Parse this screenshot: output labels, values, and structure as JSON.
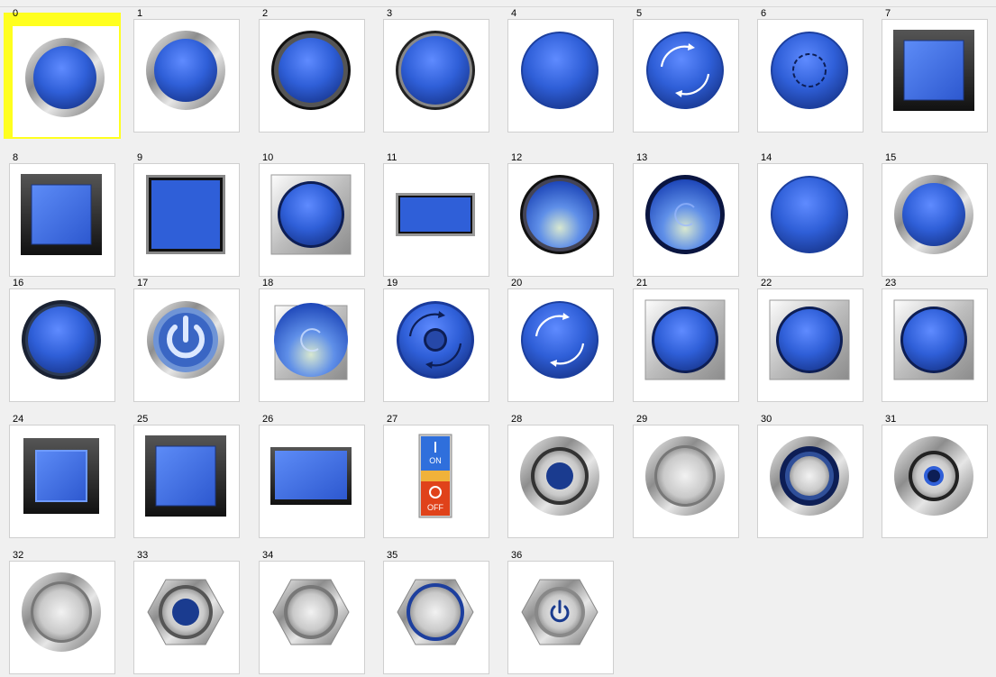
{
  "colors": {
    "accent": "#2f5fd8",
    "selection": "#ffff1f"
  },
  "buttons": [
    {
      "label": "0",
      "style": "round-chrome-bezel"
    },
    {
      "label": "1",
      "style": "round-chrome-bezel"
    },
    {
      "label": "2",
      "style": "round-black-bezel"
    },
    {
      "label": "3",
      "style": "round-thin-black-ring"
    },
    {
      "label": "4",
      "style": "round-flat"
    },
    {
      "label": "5",
      "style": "round-rotate-arrows"
    },
    {
      "label": "6",
      "style": "round-dashed-circle"
    },
    {
      "label": "7",
      "style": "square-black-bezel"
    },
    {
      "label": "8",
      "style": "square-black-bezel"
    },
    {
      "label": "9",
      "style": "square-thin-frame"
    },
    {
      "label": "10",
      "style": "round-on-metal-plate"
    },
    {
      "label": "11",
      "style": "rectangle"
    },
    {
      "label": "12",
      "style": "round-glossy-dark-ring"
    },
    {
      "label": "13",
      "style": "round-glossy-swirl"
    },
    {
      "label": "14",
      "style": "round-flat"
    },
    {
      "label": "15",
      "style": "round-chrome-bezel"
    },
    {
      "label": "16",
      "style": "round-dark-ring"
    },
    {
      "label": "17",
      "style": "power-symbol"
    },
    {
      "label": "18",
      "style": "round-glossy-swirl-plate"
    },
    {
      "label": "19",
      "style": "round-rotate-dark-center"
    },
    {
      "label": "20",
      "style": "round-rotate-arrows"
    },
    {
      "label": "21",
      "style": "round-on-metal-plate"
    },
    {
      "label": "22",
      "style": "round-on-metal-plate"
    },
    {
      "label": "23",
      "style": "round-on-metal-plate"
    },
    {
      "label": "24",
      "style": "square-black-bezel-glow"
    },
    {
      "label": "25",
      "style": "square-black-bezel"
    },
    {
      "label": "26",
      "style": "rectangle-black-bezel"
    },
    {
      "label": "27",
      "style": "on-off-switch",
      "on_text": "ON",
      "off_text": "OFF"
    },
    {
      "label": "28",
      "style": "metal-round-blue-center"
    },
    {
      "label": "29",
      "style": "metal-round"
    },
    {
      "label": "30",
      "style": "metal-round-blue-ring"
    },
    {
      "label": "31",
      "style": "metal-round-blue-dot"
    },
    {
      "label": "32",
      "style": "metal-round"
    },
    {
      "label": "33",
      "style": "hex-metal-blue-center"
    },
    {
      "label": "34",
      "style": "hex-metal"
    },
    {
      "label": "35",
      "style": "hex-metal-blue-ring"
    },
    {
      "label": "36",
      "style": "hex-metal-power"
    }
  ]
}
